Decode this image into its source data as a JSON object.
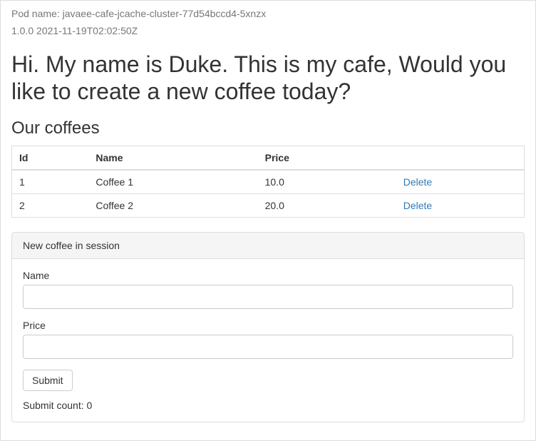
{
  "header": {
    "pod_name": "Pod name: javaee-cafe-jcache-cluster-77d54bccd4-5xnzx",
    "version": "1.0.0 2021-11-19T02:02:50Z"
  },
  "title": "Hi. My name is Duke. This is my cafe, Would you like to create a new coffee today?",
  "section_title": "Our coffees",
  "table": {
    "headers": {
      "id": "Id",
      "name": "Name",
      "price": "Price",
      "actions": ""
    },
    "rows": [
      {
        "id": "1",
        "name": "Coffee 1",
        "price": "10.0",
        "delete": "Delete"
      },
      {
        "id": "2",
        "name": "Coffee 2",
        "price": "20.0",
        "delete": "Delete"
      }
    ]
  },
  "form": {
    "panel_title": "New coffee in session",
    "name_label": "Name",
    "name_value": "",
    "price_label": "Price",
    "price_value": "",
    "submit_label": "Submit",
    "submit_count_label": "Submit count: 0"
  }
}
